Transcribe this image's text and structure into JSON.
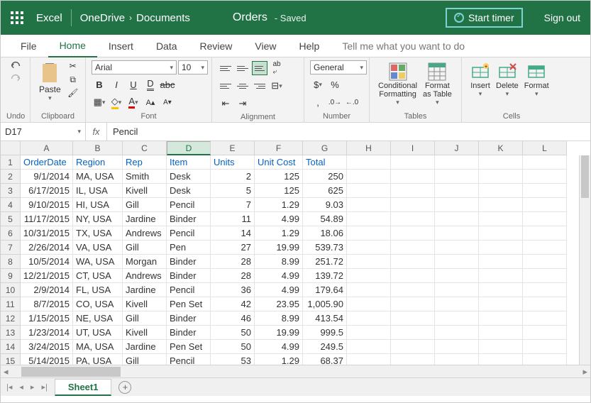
{
  "titlebar": {
    "app": "Excel",
    "breadcrumb": [
      "OneDrive",
      "Documents"
    ],
    "doc": "Orders",
    "status": "Saved",
    "start_timer": "Start timer",
    "signout": "Sign out"
  },
  "menu": {
    "items": [
      "File",
      "Home",
      "Insert",
      "Data",
      "Review",
      "View",
      "Help"
    ],
    "active": 1,
    "tellme": "Tell me what you want to do"
  },
  "ribbon": {
    "undo": "Undo",
    "clipboard": "Clipboard",
    "paste": "Paste",
    "font": {
      "name": "Arial",
      "size": "10",
      "label": "Font"
    },
    "alignment": "Alignment",
    "number": {
      "format": "General",
      "label": "Number"
    },
    "tables": {
      "cond": "Conditional\nFormatting",
      "fmt": "Format\nas Table",
      "label": "Tables"
    },
    "cells": {
      "insert": "Insert",
      "delete": "Delete",
      "format": "Format",
      "label": "Cells"
    }
  },
  "namebox": "D17",
  "formula": "Pencil",
  "columns": [
    "A",
    "B",
    "C",
    "D",
    "E",
    "F",
    "G",
    "H",
    "I",
    "J",
    "K",
    "L"
  ],
  "selected_col": 3,
  "headers": [
    "OrderDate",
    "Region",
    "Rep",
    "Item",
    "Units",
    "Unit Cost",
    "Total"
  ],
  "rows": [
    [
      "9/1/2014",
      "MA, USA",
      "Smith",
      "Desk",
      "2",
      "125",
      "250"
    ],
    [
      "6/17/2015",
      "IL, USA",
      "Kivell",
      "Desk",
      "5",
      "125",
      "625"
    ],
    [
      "9/10/2015",
      "HI, USA",
      "Gill",
      "Pencil",
      "7",
      "1.29",
      "9.03"
    ],
    [
      "11/17/2015",
      "NY, USA",
      "Jardine",
      "Binder",
      "11",
      "4.99",
      "54.89"
    ],
    [
      "10/31/2015",
      "TX, USA",
      "Andrews",
      "Pencil",
      "14",
      "1.29",
      "18.06"
    ],
    [
      "2/26/2014",
      "VA, USA",
      "Gill",
      "Pen",
      "27",
      "19.99",
      "539.73"
    ],
    [
      "10/5/2014",
      "WA, USA",
      "Morgan",
      "Binder",
      "28",
      "8.99",
      "251.72"
    ],
    [
      "12/21/2015",
      "CT, USA",
      "Andrews",
      "Binder",
      "28",
      "4.99",
      "139.72"
    ],
    [
      "2/9/2014",
      "FL, USA",
      "Jardine",
      "Pencil",
      "36",
      "4.99",
      "179.64"
    ],
    [
      "8/7/2015",
      "CO, USA",
      "Kivell",
      "Pen Set",
      "42",
      "23.95",
      "1,005.90"
    ],
    [
      "1/15/2015",
      "NE, USA",
      "Gill",
      "Binder",
      "46",
      "8.99",
      "413.54"
    ],
    [
      "1/23/2014",
      "UT, USA",
      "Kivell",
      "Binder",
      "50",
      "19.99",
      "999.5"
    ],
    [
      "3/24/2015",
      "MA, USA",
      "Jardine",
      "Pen Set",
      "50",
      "4.99",
      "249.5"
    ],
    [
      "5/14/2015",
      "PA, USA",
      "Gill",
      "Pencil",
      "53",
      "1.29",
      "68.37"
    ]
  ],
  "numcols": [
    0,
    4,
    5,
    6
  ],
  "sheet": "Sheet1",
  "fx": "fx"
}
